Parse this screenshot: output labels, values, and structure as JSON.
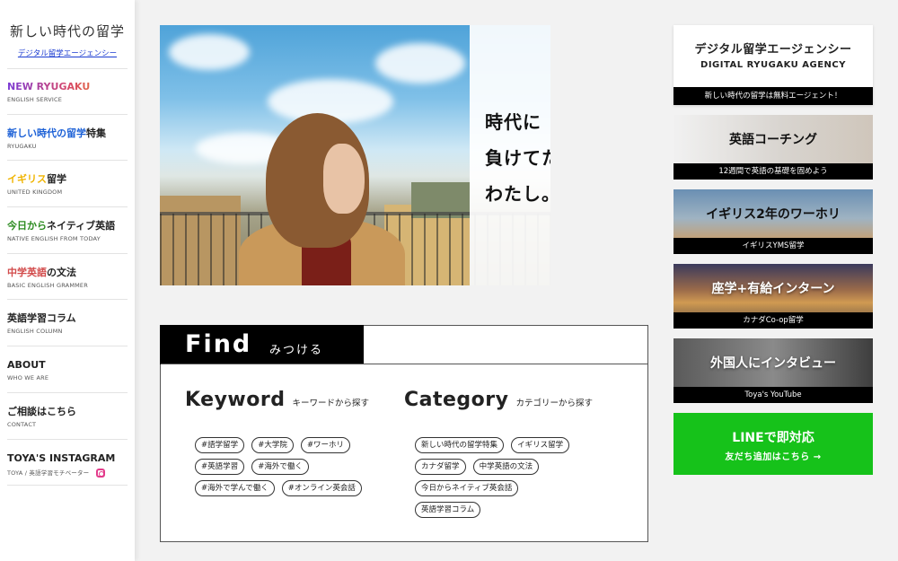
{
  "sidebar": {
    "logo_title": "新しい時代の留学",
    "logo_link": "デジタル留学エージェンシー",
    "items": [
      {
        "title": "NEW RYUGAKU",
        "sub": "ENGLISH SERVICE"
      },
      {
        "title_accent": "新しい時代の留学",
        "title_rest": "特集",
        "sub": "RYUGAKU"
      },
      {
        "title_accent": "イギリス",
        "title_rest": "留学",
        "sub": "UNITED KINGDOM"
      },
      {
        "title_accent": "今日から",
        "title_rest": "ネイティブ英語",
        "sub": "NATIVE ENGLISH FROM TODAY"
      },
      {
        "title_accent": "中学英語",
        "title_rest": "の文法",
        "sub": "BASIC ENGLISH GRAMMER"
      },
      {
        "title": "英語学習コラム",
        "sub": "ENGLISH COLUMN"
      },
      {
        "title": "ABOUT",
        "sub": "WHO WE ARE"
      },
      {
        "title": "ご相談はこちら",
        "sub": "CONTACT"
      },
      {
        "title": "TOYA'S INSTAGRAM",
        "sub": "TOYA / 英語学習モチベーター"
      }
    ]
  },
  "hero": {
    "lines": [
      "時代に",
      "負けてたまるか",
      "わたし。"
    ]
  },
  "find": {
    "title": "Find",
    "subtitle": "みつける",
    "keyword": {
      "heading": "Keyword",
      "sub": "キーワードから探す",
      "tags": [
        [
          "#語学留学",
          "#大学院",
          "#ワーホリ"
        ],
        [
          "#英語学習",
          "#海外で働く"
        ],
        [
          "#海外で学んで働く",
          "#オンライン英会話"
        ]
      ]
    },
    "category": {
      "heading": "Category",
      "sub": "カテゴリーから探す",
      "tags": [
        [
          "新しい時代の留学特集",
          "イギリス留学"
        ],
        [
          "カナダ留学",
          "中学英語の文法"
        ],
        [
          "今日からネイティブ英会話"
        ],
        [
          "英語学習コラム"
        ]
      ]
    }
  },
  "right": {
    "agency": {
      "title_jp": "デジタル留学エージェンシー",
      "title_en": "DIGITAL RYUGAKU AGENCY",
      "bar": "新しい時代の留学は無料エージェント！"
    },
    "banners": [
      {
        "title": "英語コーチング",
        "bar": "12週間で英語の基礎を固めよう"
      },
      {
        "title": "イギリス2年のワーホリ",
        "bar": "イギリスYMS留学"
      },
      {
        "title": "座学+有給インターン",
        "bar": "カナダCo-op留学"
      },
      {
        "title": "外国人にインタビュー",
        "bar": "Toya's YouTube"
      }
    ],
    "line": {
      "title": "LINEで即対応",
      "sub": "友だち追加はこちら →"
    }
  },
  "colors": {
    "accent_blue": "#1a5fd6",
    "accent_yellow": "#f0b400",
    "accent_green": "#2a8a1e",
    "accent_red": "#d24b4b",
    "line_green": "#16c21a"
  }
}
